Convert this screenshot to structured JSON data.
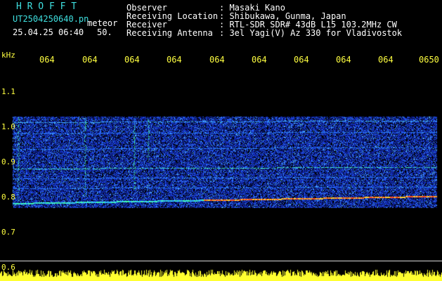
{
  "header": {
    "app_name": "H R O F F T",
    "file_name": "UT2504250640.pn",
    "tag": "meteor",
    "date_time": "25.04.25 06:40",
    "value": "50.",
    "fields": [
      {
        "label": "Observer",
        "value": ": Masaki Kano"
      },
      {
        "label": "Receiving Location",
        "value": ": Shibukawa, Gunma, Japan"
      },
      {
        "label": "Receiver",
        "value": ": RTL-SDR SDR# 43dB L15 103.2MHz CW"
      },
      {
        "label": "Receiving Antenna",
        "value": ": 3el Yagi(V) Az 330 for Vladivostok"
      }
    ]
  },
  "x_ticks": [
    "064",
    "064",
    "064",
    "064",
    "064",
    "064",
    "064",
    "064",
    "064",
    "0650"
  ],
  "y_axis": {
    "unit": "kHz",
    "ticks": [
      "1.1",
      "1.0",
      "0.9",
      "0.8",
      "0.7",
      "0.6"
    ]
  },
  "colors": {
    "background": "#000000",
    "header_title": "#3fe0e0",
    "header_text": "#ffffff",
    "axis_text": "#ffff40"
  }
}
